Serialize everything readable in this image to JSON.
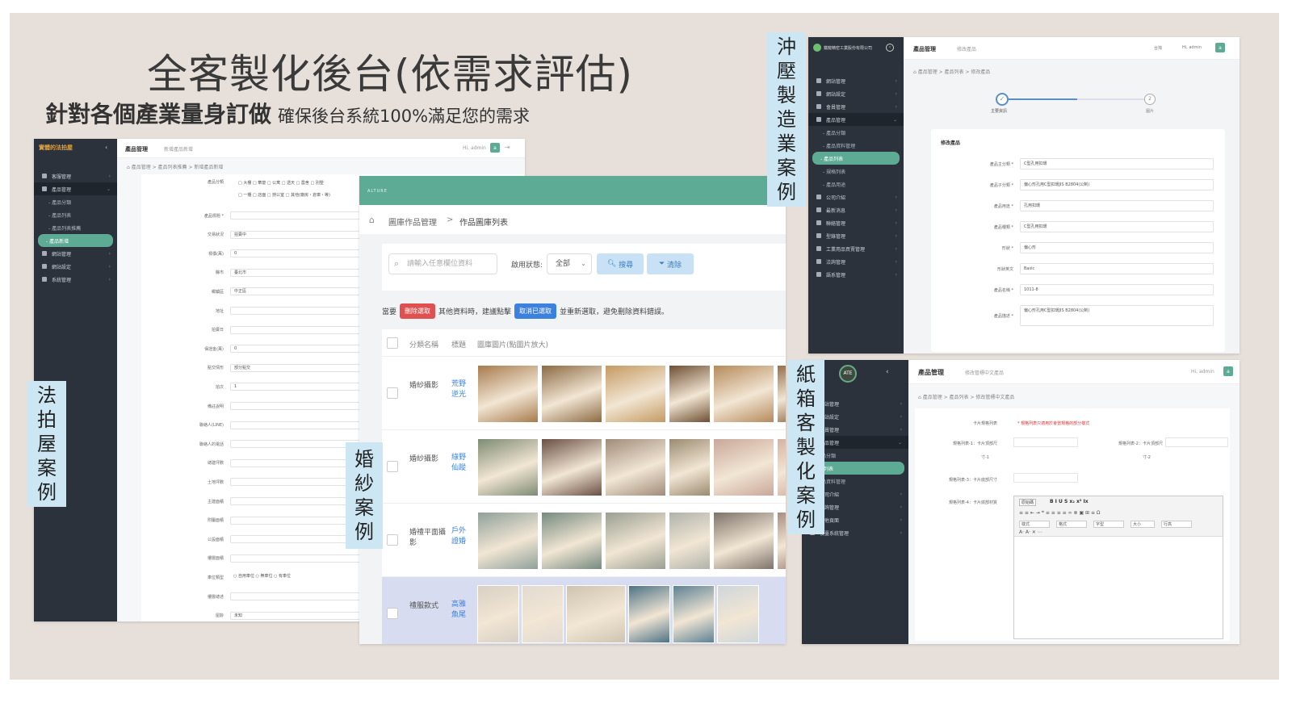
{
  "heading": {
    "title": "全客製化後台(依需求評估)",
    "subtitle_bold": "針對各個產業量身訂做",
    "subtitle_plain": "確保後台系統100%滿足您的需求"
  },
  "labels": {
    "law": [
      "法",
      "拍",
      "屋",
      "案",
      "例"
    ],
    "wedding": [
      "婚",
      "紗",
      "案",
      "例"
    ],
    "manufacture": [
      "沖",
      "壓",
      "製",
      "造",
      "業",
      "案",
      "例"
    ],
    "carton": [
      "紙",
      "箱",
      "客",
      "製",
      "化",
      "案",
      "例"
    ]
  },
  "panel_law": {
    "logo_text": "實體的法拍屋",
    "title": "產品管理",
    "subtitle": "新增產品新增",
    "user": "Hi, admin",
    "avatar": "a",
    "breadcrumb": "產品管理 > 產品列表推薦 > 新增產品新增",
    "sidebar": [
      {
        "label": "客服管理",
        "kind": "item"
      },
      {
        "label": "產品管理",
        "kind": "open"
      },
      {
        "label": "- 產品分類",
        "kind": "sub"
      },
      {
        "label": "- 產品列表",
        "kind": "sub"
      },
      {
        "label": "- 產品列表推薦",
        "kind": "sub"
      },
      {
        "label": "- 產品新增",
        "kind": "active"
      },
      {
        "label": "網站管理",
        "kind": "item"
      },
      {
        "label": "網站設定",
        "kind": "item"
      },
      {
        "label": "系統管理",
        "kind": "item"
      }
    ],
    "checkbox_row1": "□ 大樓  □ 華廈  □ 公寓  □ 透天  □ 農舍  □ 別墅",
    "checkbox_row2": "□ 一樓  □ 店面  □ 辦公室  □ 其他(廠房・倉庫・等)",
    "fields": [
      {
        "label": "產品分類",
        "value": ""
      },
      {
        "label": "產品標題 *",
        "value": ""
      },
      {
        "label": "交易狀況",
        "value": "拍賣中"
      },
      {
        "label": "標價(萬)",
        "value": "0"
      },
      {
        "label": "縣市",
        "value": "臺北市"
      },
      {
        "label": "鄉鎮區",
        "value": "中正區"
      },
      {
        "label": "地址",
        "value": ""
      },
      {
        "label": "拍賣日",
        "value": ""
      },
      {
        "label": "保證金(萬)",
        "value": "0"
      },
      {
        "label": "點交情形",
        "value": "部分點交"
      },
      {
        "label": "拍次",
        "value": "1"
      },
      {
        "label": "備註說明",
        "value": ""
      },
      {
        "label": "聯絡人(LINE)",
        "value": ""
      },
      {
        "label": "聯絡人的電話",
        "value": ""
      },
      {
        "label": "總建坪數",
        "value": ""
      },
      {
        "label": "土地坪數",
        "value": ""
      },
      {
        "label": "主建面積",
        "value": ""
      },
      {
        "label": "附屬面積",
        "value": ""
      },
      {
        "label": "公設面積",
        "value": ""
      },
      {
        "label": "樓層面積",
        "value": ""
      },
      {
        "label": "車位類型",
        "value": "○ 自用車位  ○ 無車位  ○ 有車位"
      },
      {
        "label": "樓層總述",
        "value": ""
      },
      {
        "label": "屋齡",
        "value": "未知"
      }
    ]
  },
  "panel_wedding": {
    "logo_text": "ALTURE",
    "breadcrumb_root": "圖庫作品管理",
    "breadcrumb_sep": ">",
    "breadcrumb_current": "作品圖庫列表",
    "search_placeholder": "請輸入任意欄位資料",
    "status_label": "啟用狀態:",
    "status_value": "全部",
    "search_btn": "搜尋",
    "clear_btn": "清除",
    "notice_prefix": "當要",
    "notice_btn1": "刪除選取",
    "notice_mid": "其他資料時，建議點擊",
    "notice_btn2": "取消已選取",
    "notice_suffix": "並重新選取，避免刪除資料錯誤。",
    "columns": [
      "分類名稱",
      "標題",
      "圖庫圖片(點圖片放大)"
    ],
    "rows": [
      {
        "category": "婚紗攝影",
        "title": "荒野逆光",
        "colors": [
          "#a77b4e",
          "#8c6a44",
          "#c49a62",
          "#6e4e34",
          "#b58a5c",
          "#93704b"
        ]
      },
      {
        "category": "婚紗攝影",
        "title": "綠野仙蹤",
        "colors": [
          "#7e8b74",
          "#6a4f44",
          "#a08b7a",
          "#9a8a70",
          "#c9a79a",
          "#d6b2a2"
        ]
      },
      {
        "category": "婚禮平面攝影",
        "title": "戶外證婚",
        "colors": [
          "#8fa09a",
          "#768a80",
          "#9a9f92",
          "#b0b3ab",
          "#7d7368",
          "#a78d80"
        ]
      },
      {
        "category": "禮服款式",
        "title": "高雅魚尾",
        "colors": [
          "#d8d0c4",
          "#e2dbd2",
          "#cfc3b1",
          "#4e7386",
          "#5d8294",
          "#cfd6da"
        ]
      }
    ]
  },
  "panel_manufacture": {
    "company": "鐵龍精密工業股份有限公司",
    "title": "產品管理",
    "subtitle": "修改產品",
    "lang": "台灣",
    "user": "Hi, admin",
    "avatar": "a",
    "breadcrumb": "產品管理 > 產品列表 > 修改產品",
    "step1": "主要資訊",
    "step2": "圖片",
    "step2_num": "2",
    "card_title": "修改產品",
    "sidebar": [
      {
        "label": "網站管理",
        "kind": "item"
      },
      {
        "label": "網站設定",
        "kind": "item"
      },
      {
        "label": "會員管理",
        "kind": "item"
      },
      {
        "label": "產品管理",
        "kind": "open"
      },
      {
        "label": "- 產品分類",
        "kind": "sub"
      },
      {
        "label": "- 產品資料管理",
        "kind": "sub"
      },
      {
        "label": "- 產品列表",
        "kind": "active"
      },
      {
        "label": "- 規格列表",
        "kind": "sub"
      },
      {
        "label": "- 產品用途",
        "kind": "sub"
      },
      {
        "label": "公司介紹",
        "kind": "item"
      },
      {
        "label": "最新消息",
        "kind": "item"
      },
      {
        "label": "聯絡管理",
        "kind": "item"
      },
      {
        "label": "型錄管理",
        "kind": "item"
      },
      {
        "label": "工業用品買賣管理",
        "kind": "item"
      },
      {
        "label": "洽詢管理",
        "kind": "item"
      },
      {
        "label": "語系管理",
        "kind": "item"
      }
    ],
    "fields": [
      {
        "label": "產品主分類 *",
        "value": "C型孔用扣環"
      },
      {
        "label": "產品子分類 *",
        "value": "偏心形孔用C型扣環JIS B2804(公制)"
      },
      {
        "label": "產品用途 *",
        "value": "孔用扣環"
      },
      {
        "label": "產品種類 *",
        "value": "C型孔用扣環"
      },
      {
        "label": "形狀 *",
        "value": "偏心形"
      },
      {
        "label": "形狀英文",
        "value": "Basic"
      },
      {
        "label": "產品名稱 *",
        "value": "1011-8"
      },
      {
        "label": "產品描述 *",
        "value": "偏心形孔用C型扣環JIS B2804(公制)"
      }
    ]
  },
  "panel_carton": {
    "logo_text": "ATE",
    "title": "產品管理",
    "subtitle": "修改管標中文產品",
    "user": "Hi, admin",
    "avatar": "a",
    "breadcrumb": "產品管理 > 產品列表 > 修改管標中文產品",
    "sidebar": [
      {
        "label": "網站管理",
        "kind": "item"
      },
      {
        "label": "全站設定",
        "kind": "item"
      },
      {
        "label": "會員管理",
        "kind": "item"
      },
      {
        "label": "產品管理",
        "kind": "open"
      },
      {
        "label": "產品分類",
        "kind": "sub"
      },
      {
        "label": "產品列表",
        "kind": "active"
      },
      {
        "label": "產品資料管理",
        "kind": "sub"
      },
      {
        "label": "公司介紹",
        "kind": "item"
      },
      {
        "label": "洽詢管理",
        "kind": "item"
      },
      {
        "label": "其他頁面",
        "kind": "item"
      },
      {
        "label": "後臺系統管理",
        "kind": "item"
      }
    ],
    "f1_label": "卡片規格列表",
    "f1_hint": "* 規格列表只適用於會當規格的部分樣式",
    "f2_label": "規格列表-1：卡片頂部尺",
    "f2_right_label": "規格列表-2：卡片頂部尺",
    "f2_sub": "寸-1",
    "f2_right_sub": "寸-2",
    "f3_label": "規格列表-3：卡片底部尺寸",
    "f4_label": "規格列表-4：卡片底部材質",
    "editor_source": "原始碼",
    "editor_row1": "B  I  U  S  x₂  x²  Ix",
    "editor_row2": "≡  ≡  ⇤  ⇥  ❝  ≡  ≡  ≡  ≡  ∞  ⊗  ▣  ⊞  ≡  Ω",
    "editor_dd1": "樣式",
    "editor_dd2": "格式",
    "editor_dd3": "字型",
    "editor_dd4": "大小",
    "editor_dd5": "行高",
    "editor_row3": "A·  A·  ✕  ⋯"
  }
}
